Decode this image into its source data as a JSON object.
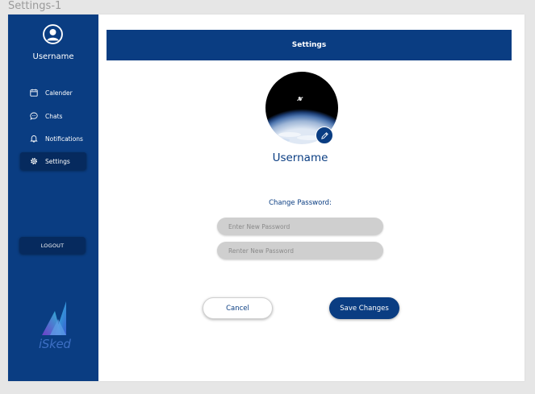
{
  "frame": {
    "title": "Settings-1"
  },
  "sidebar": {
    "username": "Username",
    "items": [
      {
        "label": "Calender",
        "icon": "calendar-icon"
      },
      {
        "label": "Chats",
        "icon": "chat-icon"
      },
      {
        "label": "Notifications",
        "icon": "bell-icon"
      },
      {
        "label": "Settings",
        "icon": "gear-icon",
        "active": true
      }
    ],
    "logout_label": "LOGOUT",
    "logo_text": "iSked"
  },
  "header": {
    "title": "Settings"
  },
  "profile": {
    "username": "Username",
    "change_password_label": "Change Password:",
    "new_password_placeholder": "Enter New Password",
    "reenter_password_placeholder": "Renter New Password"
  },
  "actions": {
    "cancel_label": "Cancel",
    "save_label": "Save Changes"
  },
  "colors": {
    "primary": "#0a3d82",
    "primary_dark": "#062a5e",
    "input_bg": "#cfcfcf",
    "page_bg": "#e6e6e6"
  }
}
